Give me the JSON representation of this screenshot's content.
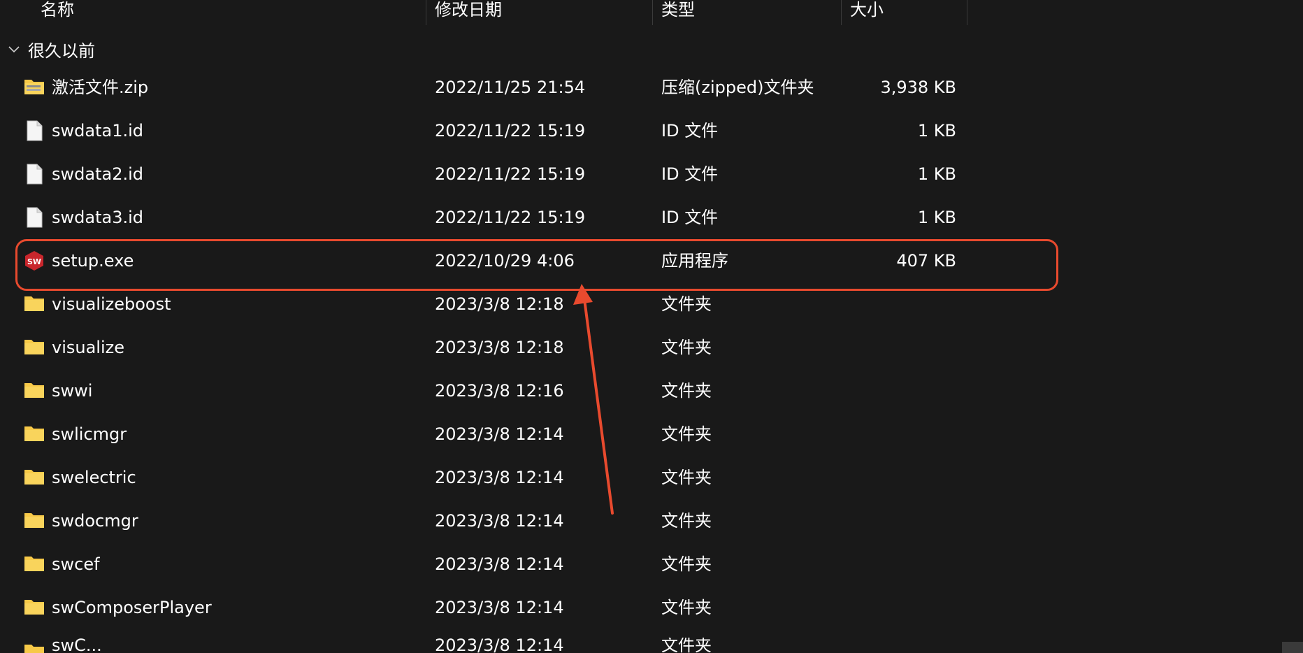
{
  "columns": {
    "name": "名称",
    "date": "修改日期",
    "type": "类型",
    "size": "大小"
  },
  "group": {
    "label": "很久以前",
    "icon": "chevron-down-icon"
  },
  "files": [
    {
      "name": "激活文件.zip",
      "date": "2022/11/25 21:54",
      "type": "压缩(zipped)文件夹",
      "size": "3,938 KB",
      "icon": "zip-folder-icon"
    },
    {
      "name": "swdata1.id",
      "date": "2022/11/22 15:19",
      "type": "ID 文件",
      "size": "1 KB",
      "icon": "file-icon"
    },
    {
      "name": "swdata2.id",
      "date": "2022/11/22 15:19",
      "type": "ID 文件",
      "size": "1 KB",
      "icon": "file-icon"
    },
    {
      "name": "swdata3.id",
      "date": "2022/11/22 15:19",
      "type": "ID 文件",
      "size": "1 KB",
      "icon": "file-icon"
    },
    {
      "name": "setup.exe",
      "date": "2022/10/29 4:06",
      "type": "应用程序",
      "size": "407 KB",
      "icon": "solidworks-app-icon"
    },
    {
      "name": "visualizeboost",
      "date": "2023/3/8 12:18",
      "type": "文件夹",
      "size": "",
      "icon": "folder-icon"
    },
    {
      "name": "visualize",
      "date": "2023/3/8 12:18",
      "type": "文件夹",
      "size": "",
      "icon": "folder-icon"
    },
    {
      "name": "swwi",
      "date": "2023/3/8 12:16",
      "type": "文件夹",
      "size": "",
      "icon": "folder-icon"
    },
    {
      "name": "swlicmgr",
      "date": "2023/3/8 12:14",
      "type": "文件夹",
      "size": "",
      "icon": "folder-icon"
    },
    {
      "name": "swelectric",
      "date": "2023/3/8 12:14",
      "type": "文件夹",
      "size": "",
      "icon": "folder-icon"
    },
    {
      "name": "swdocmgr",
      "date": "2023/3/8 12:14",
      "type": "文件夹",
      "size": "",
      "icon": "folder-icon"
    },
    {
      "name": "swcef",
      "date": "2023/3/8 12:14",
      "type": "文件夹",
      "size": "",
      "icon": "folder-icon"
    },
    {
      "name": "swComposerPlayer",
      "date": "2023/3/8 12:14",
      "type": "文件夹",
      "size": "",
      "icon": "folder-icon"
    }
  ],
  "partial_row": {
    "name": "swC...",
    "date": "2023/3/8 12:14",
    "type": "文件夹"
  },
  "colors": {
    "background": "#191919",
    "text": "#ffffff",
    "annotation": "#e84a2e",
    "folder": "#f7c948"
  }
}
